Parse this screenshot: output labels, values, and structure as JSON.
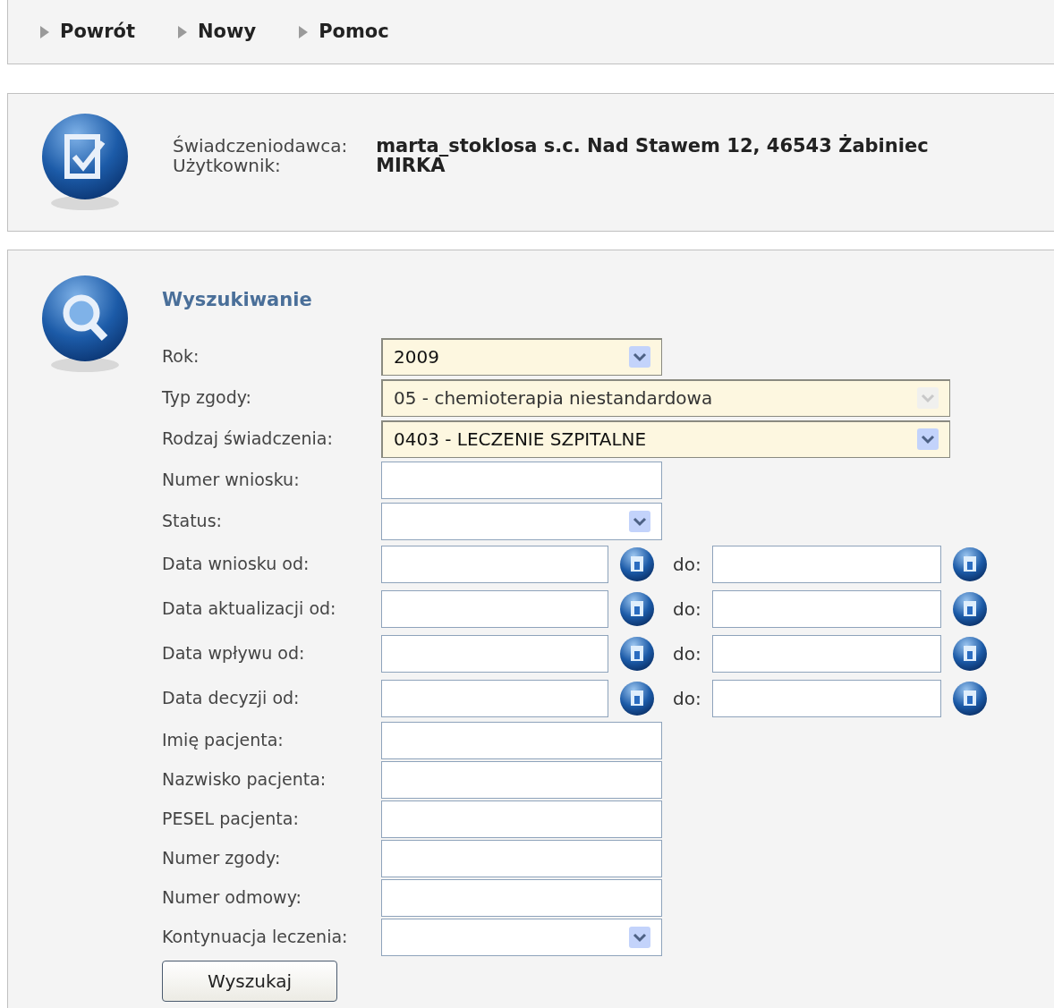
{
  "nav": [
    {
      "label": "Powrót"
    },
    {
      "label": "Nowy"
    },
    {
      "label": "Pomoc"
    }
  ],
  "info": [
    {
      "label": "Świadczeniodawca:",
      "value": "marta_stoklosa s.c. Nad Stawem 12, 46543 Żabiniec"
    },
    {
      "label": "Użytkownik:",
      "value": "MIRKA"
    }
  ],
  "search": {
    "title": "Wyszukiwanie",
    "fields": [
      {
        "kind": "select",
        "label": "Rok:",
        "value": "2009",
        "wide": false,
        "highlighted": true,
        "disabled": false
      },
      {
        "kind": "select",
        "label": "Typ zgody:",
        "value": "05 - chemioterapia niestandardowa",
        "wide": true,
        "highlighted": true,
        "disabled": true
      },
      {
        "kind": "select",
        "label": "Rodzaj świadczenia:",
        "value": "0403 - LECZENIE SZPITALNE",
        "wide": true,
        "highlighted": true,
        "disabled": false
      },
      {
        "kind": "text",
        "label": "Numer wniosku:"
      },
      {
        "kind": "select",
        "label": "Status:",
        "wide": false,
        "highlighted": false,
        "disabled": false
      },
      {
        "kind": "daterange",
        "label": "Data wniosku od:",
        "to_label": "do:"
      },
      {
        "kind": "daterange",
        "label": "Data aktualizacji od:",
        "to_label": "do:"
      },
      {
        "kind": "daterange",
        "label": "Data wpływu od:",
        "to_label": "do:"
      },
      {
        "kind": "daterange",
        "label": "Data decyzji od:",
        "to_label": "do:"
      },
      {
        "kind": "text",
        "label": "Imię pacjenta:"
      },
      {
        "kind": "text",
        "label": "Nazwisko pacjenta:"
      },
      {
        "kind": "text",
        "label": "PESEL pacjenta:"
      },
      {
        "kind": "text",
        "label": "Numer zgody:"
      },
      {
        "kind": "text",
        "label": "Numer odmowy:"
      },
      {
        "kind": "select",
        "label": "Kontynuacja leczenia:",
        "wide": false,
        "highlighted": false,
        "disabled": false
      }
    ],
    "button": "Wyszukaj"
  }
}
